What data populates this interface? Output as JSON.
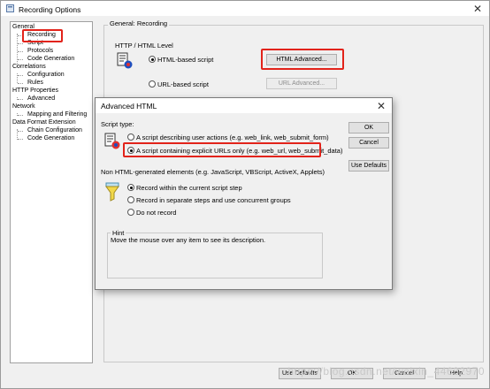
{
  "window": {
    "title": "Recording Options",
    "close_glyph": "✕"
  },
  "tree": {
    "items": [
      {
        "label": "General",
        "level": 0
      },
      {
        "label": "Recording",
        "level": 1
      },
      {
        "label": "Script",
        "level": 1
      },
      {
        "label": "Protocols",
        "level": 1
      },
      {
        "label": "Code Generation",
        "level": 1
      },
      {
        "label": "Correlations",
        "level": 0
      },
      {
        "label": "Configuration",
        "level": 1
      },
      {
        "label": "Rules",
        "level": 1
      },
      {
        "label": "HTTP Properties",
        "level": 0
      },
      {
        "label": "Advanced",
        "level": 1
      },
      {
        "label": "Network",
        "level": 0
      },
      {
        "label": "Mapping and Filtering",
        "level": 1
      },
      {
        "label": "Data Format Extension",
        "level": 0
      },
      {
        "label": "Chain Configuration",
        "level": 1
      },
      {
        "label": "Code Generation",
        "level": 1
      }
    ]
  },
  "panel": {
    "group_title": "General: Recording",
    "http_level_label": "HTTP / HTML Level",
    "html_based_label": "HTML-based script",
    "html_advanced_button": "HTML Advanced...",
    "url_based_label": "URL-based script",
    "url_advanced_button": "URL Advanced..."
  },
  "footer": {
    "use_defaults": "Use Defaults",
    "ok": "OK",
    "cancel": "Cancel",
    "help": "Help"
  },
  "dialog": {
    "title": "Advanced HTML",
    "close_glyph": "✕",
    "script_type_label": "Script type:",
    "option_user_actions": "A script describing user actions (e.g. web_link, web_submit_form)",
    "option_explicit_urls": "A script containing explicit URLs only (e.g. web_url, web_submit_data)",
    "non_html_label": "Non HTML-generated elements (e.g. JavaScript, VBScript, ActiveX, Applets)",
    "option_record_within": "Record within the current script step",
    "option_record_separate": "Record in separate steps and use concurrent groups",
    "option_do_not_record": "Do not record",
    "hint_title": "Hint",
    "hint_text": "Move the mouse over any item to see its description.",
    "ok_button": "OK",
    "cancel_button": "Cancel",
    "use_defaults_button": "Use Defaults"
  },
  "watermark": "https://blog.csdn.net/weixin_44632970",
  "colors": {
    "highlight": "#e2231a",
    "window_bg": "#f0f0f0"
  },
  "icons": [
    "app-icon",
    "script-icon",
    "filter-icon",
    "close-icon"
  ]
}
